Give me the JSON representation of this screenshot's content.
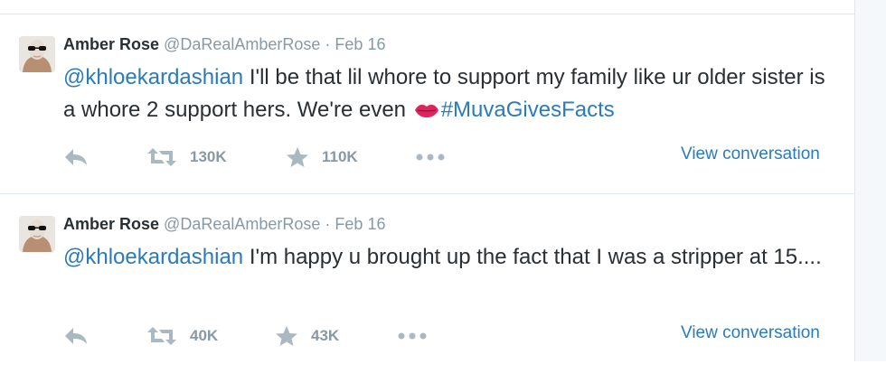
{
  "tweets": [
    {
      "name": "Amber Rose",
      "handle": "@DaRealAmberRose",
      "separator": "·",
      "date": "Feb 16",
      "mention": "@khloekardashian",
      "text": " I'll be that lil whore to support my family like ur older sister is a whore 2 support hers. We're even ",
      "hashtag": "#MuvaGivesFacts",
      "emoji": "kiss-mark-icon",
      "retweets": "130K",
      "favorites": "110K",
      "view_conversation": "View conversation"
    },
    {
      "name": "Amber Rose",
      "handle": "@DaRealAmberRose",
      "separator": "·",
      "date": "Feb 16",
      "mention": "@khloekardashian",
      "text": " I'm happy u brought up the fact that I was a stripper at 15....",
      "retweets": "40K",
      "favorites": "43K",
      "view_conversation": "View conversation"
    }
  ],
  "colors": {
    "link": "#2b7bb9",
    "text": "#292f33",
    "muted": "#8899a6",
    "icon": "#aab8c2",
    "border": "#e1e8ed",
    "lips": "#e0245e"
  }
}
